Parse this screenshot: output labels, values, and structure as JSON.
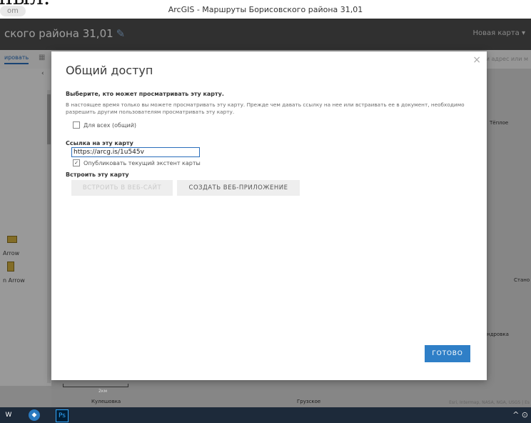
{
  "window": {
    "top_fragment": "ныл.",
    "tab_pill": "om",
    "title": "ArcGIS - Маршруты Борисовского района 31,01"
  },
  "app": {
    "map_title": "ского района 31,01",
    "new_map": "Новая карта ▾",
    "toolbar_button": "ировать",
    "search_placeholder": "ти адрес или м"
  },
  "left_panel": {
    "legend": [
      "Arrow",
      "n Arrow"
    ]
  },
  "map": {
    "labels": [
      "Тёплое",
      "Стано",
      "сандровка",
      "Кулешовка",
      "Грузское",
      "Esri, Intermap, NASA, NGA, USGS | Es"
    ],
    "scale_text": "2км"
  },
  "dialog": {
    "title": "Общий доступ",
    "close": "×",
    "who_can_view": "Выберите, кто может просматривать эту карту.",
    "description": "В настоящее время только вы можете просматривать эту карту. Прежде чем давать ссылку на нее или встраивать ее в документ, необходимо разрешить другим пользователям просматривать эту карту.",
    "everyone_label": "Для всех (общий)",
    "everyone_checked": false,
    "link_heading": "Ссылка на эту карту",
    "link_value": "https://arcg.is/1u545v",
    "publish_extent_label": "Опубликовать текущий экстент карты",
    "publish_extent_checked": true,
    "embed_heading": "Встроить эту карту",
    "embed_website": "ВСТРОИТЬ В ВЕБ-САЙТ",
    "create_app": "СОЗДАТЬ ВЕБ-ПРИЛОЖЕНИЕ",
    "done": "ГОТОВО"
  },
  "taskbar": {
    "tray": "^ ⊙"
  },
  "colors": {
    "accent": "#2f7fc7",
    "header": "#4e4e4e",
    "taskbar": "#1d2a3a"
  }
}
